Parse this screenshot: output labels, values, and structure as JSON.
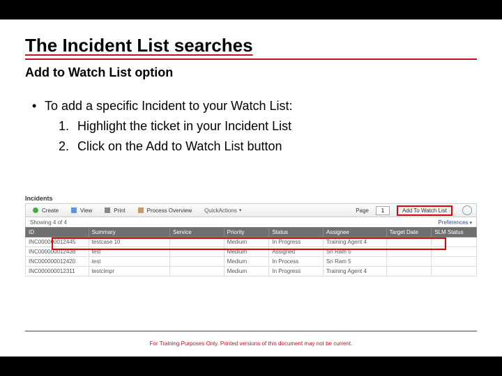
{
  "title": "The Incident List searches",
  "subtitle": "Add to Watch List option",
  "bullet_intro": "To add a specific Incident to your Watch List:",
  "steps": {
    "n1": "1.",
    "s1": "Highlight the ticket in your Incident List",
    "n2": "2.",
    "s2": "Click on the Add to Watch List button"
  },
  "footer": "For Training Purposes Only. Printed versions of this document may not be current.",
  "app": {
    "section": "Incidents",
    "toolbar": {
      "create": "Create",
      "view": "View",
      "print": "Print",
      "process": "Process Overview",
      "quick": "QuickActions",
      "page_label": "Page",
      "page_value": "1",
      "add_watch": "Add To Watch List"
    },
    "infobar": {
      "showing": "Showing   4 of 4",
      "preferences": "Preferences"
    },
    "columns": {
      "id": "ID",
      "summary": "Summary",
      "service": "Service",
      "priority": "Priority",
      "status": "Status",
      "assignee": "Assignee",
      "target": "Target Date",
      "slm": "SLM Status"
    },
    "rows": [
      {
        "id": "INC000000012445",
        "summary": "testcase 10",
        "service": "",
        "priority": "Medium",
        "status": "In Progress",
        "assignee": "Training Agent 4",
        "target": "",
        "slm": ""
      },
      {
        "id": "INC000000012438",
        "summary": "test",
        "service": "",
        "priority": "Medium",
        "status": "Assigned",
        "assignee": "Sri Ram 5",
        "target": "",
        "slm": ""
      },
      {
        "id": "INC000000012420",
        "summary": "test",
        "service": "",
        "priority": "Medium",
        "status": "In Process",
        "assignee": "Sri Ram 5",
        "target": "",
        "slm": ""
      },
      {
        "id": "INC000000012311",
        "summary": "testcimpr",
        "service": "",
        "priority": "Medium",
        "status": "In Progress",
        "assignee": "Training Agent 4",
        "target": "",
        "slm": ""
      }
    ]
  }
}
